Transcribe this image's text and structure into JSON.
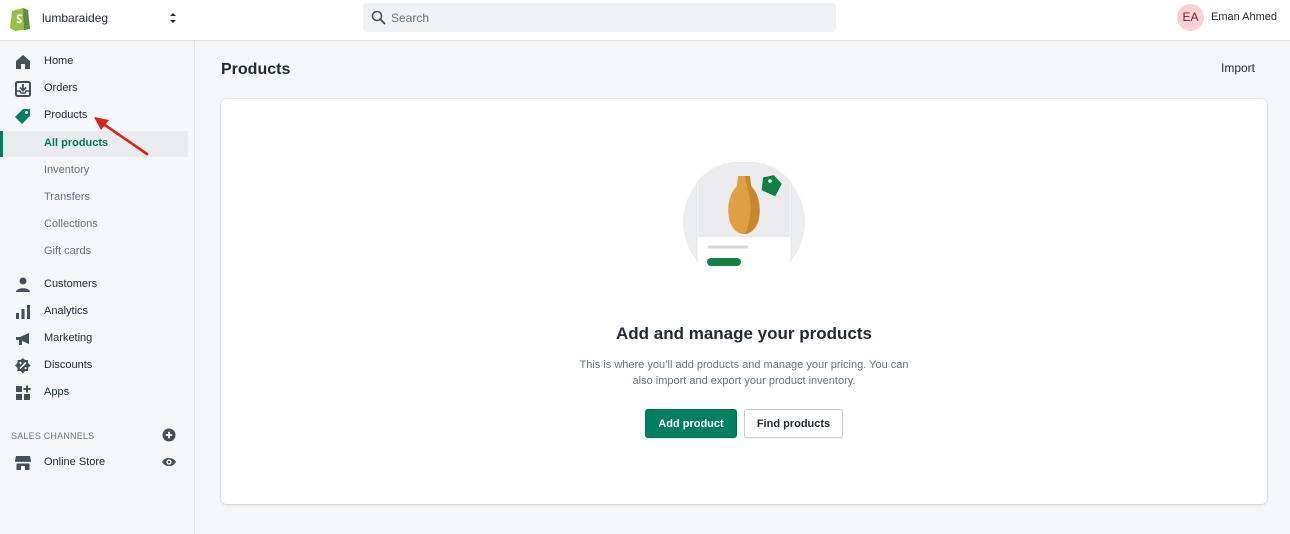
{
  "topbar": {
    "store_name": "lumbaraideg",
    "search_placeholder": "Search",
    "user_initials": "EA",
    "user_name": "Eman Ahmed"
  },
  "sidebar": {
    "items": [
      {
        "label": "Home",
        "icon": "home-icon"
      },
      {
        "label": "Orders",
        "icon": "orders-icon"
      },
      {
        "label": "Products",
        "icon": "tag-icon"
      },
      {
        "label": "Customers",
        "icon": "person-icon"
      },
      {
        "label": "Analytics",
        "icon": "bar-chart-icon"
      },
      {
        "label": "Marketing",
        "icon": "megaphone-icon"
      },
      {
        "label": "Discounts",
        "icon": "discount-icon"
      },
      {
        "label": "Apps",
        "icon": "apps-icon"
      }
    ],
    "products_sub": [
      "All products",
      "Inventory",
      "Transfers",
      "Collections",
      "Gift cards"
    ],
    "selected_sub": "All products",
    "sales_channels_title": "SALES CHANNELS",
    "channels": [
      {
        "label": "Online Store",
        "icon": "store-icon"
      }
    ]
  },
  "main": {
    "title": "Products",
    "import_label": "Import",
    "empty_heading": "Add and manage your products",
    "empty_desc": "This is where you’ll add products and manage your pricing. You can also import and export your product inventory.",
    "add_product_label": "Add product",
    "find_products_label": "Find products"
  },
  "colors": {
    "brand_green": "#008060",
    "annotation_arrow": "#e0201b",
    "avatar_bg": "#fbcfd4"
  }
}
